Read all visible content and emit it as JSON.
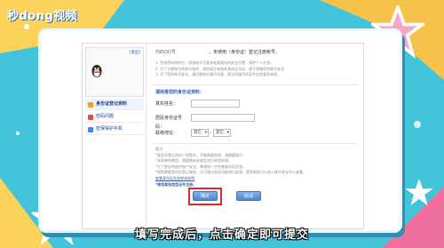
{
  "watermark": "秒dong视频",
  "page": {
    "sidebar": {
      "top_link": "[退出]",
      "items": [
        {
          "label": "身份证登记资料"
        },
        {
          "label": "密码问题"
        },
        {
          "label": "密保保护手机"
        }
      ]
    },
    "header": {
      "account_label": "你的QQ号",
      "account_value": "",
      "question": "，未使用（身份证）登记注册帐号。"
    },
    "notice": [
      "1. 完成密码保护后，用该帐号可登录各类服务的安全设置，保护个人信息。",
      "2. 为了方便帐号的账号保护，请您填写有效的身份证号码，便于保障您的账号安全",
      "3. 为了您的帐号安全，请仔细核对填写内容，保证所填写的证件信息真实有效。"
    ],
    "section_title": "请完善您的身份证资料：",
    "form": {
      "name_label": "真实姓名：",
      "name_value": "",
      "id_label": "居民身份证号码：",
      "id_value": "",
      "address_label": "联络地址：",
      "province_value": "其它",
      "city_value": "其它",
      "separator": "-"
    },
    "notes": {
      "title": "备注：",
      "lines": [
        "*身份证登记资料一经提交，不能随意修改，请慎重填写。",
        "*本表单的使用，需遵循有关规定进行校验处理。",
        "*为了更好的维护账户安全，希望进一步完善身份证信息。",
        "*如您需要身份证登记服务，还可通过申诉功能进行处理，更多帮助可以进入帐号安全中心查看。"
      ],
      "link": "查看身份证信息修改说明",
      "bottom_link": "*使用其他类型证件注册，"
    },
    "buttons": {
      "confirm": "确定",
      "cancel": "取消"
    }
  },
  "caption": "填写完成后，点击确定即可提交"
}
